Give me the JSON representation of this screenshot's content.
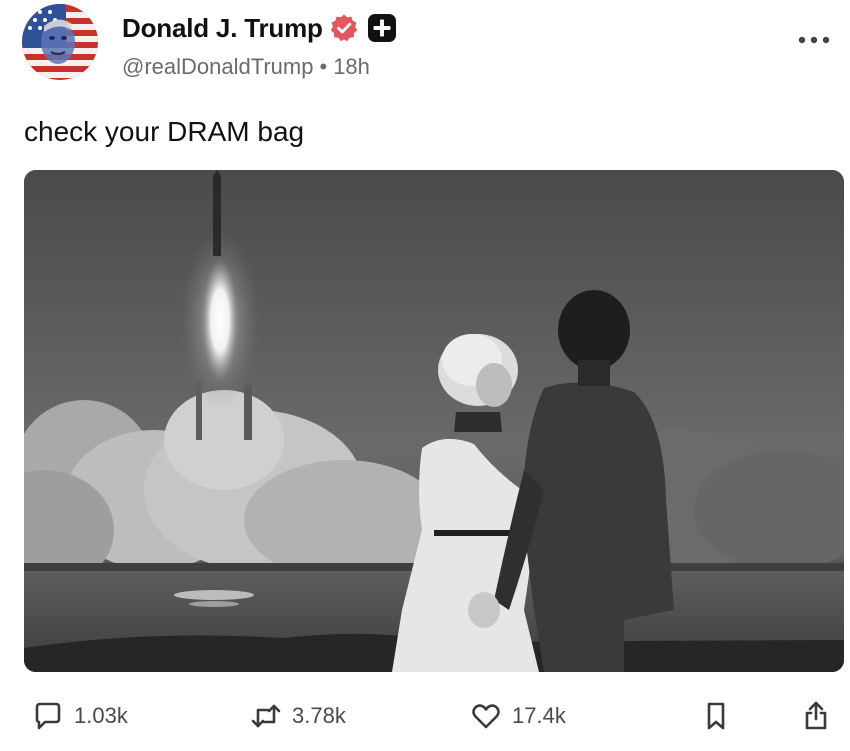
{
  "post": {
    "author": {
      "display_name": "Donald J. Trump",
      "handle": "@realDonaldTrump",
      "time_ago": "18h",
      "separator": "•"
    },
    "text": "check your DRAM bag",
    "image": {
      "description": "black and white photograph of a couple watching a rocket launch"
    },
    "actions": {
      "replies": "1.03k",
      "reposts": "3.78k",
      "likes": "17.4k"
    }
  },
  "icons": {
    "verified": "verified-badge-icon",
    "plus": "plus-badge-icon",
    "more": "more-horizontal-icon",
    "reply": "reply-icon",
    "repost": "repost-icon",
    "like": "heart-icon",
    "bookmark": "bookmark-icon",
    "share": "share-icon"
  },
  "colors": {
    "verified_badge": "#E4575E",
    "text_primary": "#111111",
    "text_secondary": "#6b6b6b",
    "icon": "#3a3a3a"
  }
}
